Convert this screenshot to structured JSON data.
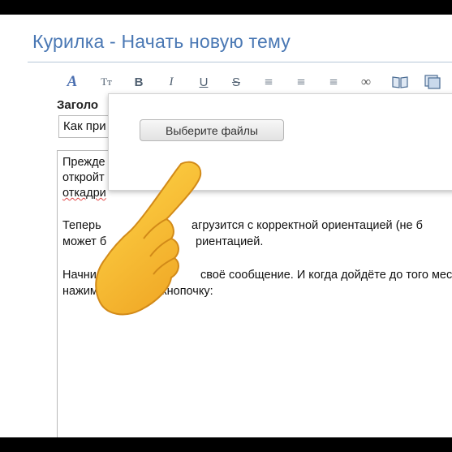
{
  "header": {
    "title": "Курилка - Начать новую тему"
  },
  "toolbar": {
    "buttons": [
      {
        "name": "font-color-icon",
        "glyph": "A"
      },
      {
        "name": "font-size-icon",
        "glyph": "Tт"
      },
      {
        "name": "bold-icon",
        "glyph": "B"
      },
      {
        "name": "italic-icon",
        "glyph": "I"
      },
      {
        "name": "underline-icon",
        "glyph": "U"
      },
      {
        "name": "strikethrough-icon",
        "glyph": "S"
      },
      {
        "name": "align-left-icon",
        "glyph": "≡"
      },
      {
        "name": "align-center-icon",
        "glyph": "≡"
      },
      {
        "name": "align-right-icon",
        "glyph": "≡"
      },
      {
        "name": "link-icon",
        "glyph": "∞"
      },
      {
        "name": "book-icon",
        "glyph": ""
      },
      {
        "name": "image-icon",
        "glyph": ""
      }
    ]
  },
  "form": {
    "subject_label": "Заголо",
    "subject_value": "Как при",
    "message_lines": [
      "Прежде",
      "откройт",
      "откадри",
      "",
      "Теперь",
      "агрузится с корректной ориентацией (не б",
      "может б",
      "риентацией.",
      "Начни",
      "своё сообщение. И когда дойдёте до того мес",
      "нажимай",
      "у кнопочку:"
    ]
  },
  "popup": {
    "file_button_label": "Выберите файлы"
  },
  "colors": {
    "title": "#4a78b4",
    "background": "#ffffff",
    "frame": "#000000"
  }
}
